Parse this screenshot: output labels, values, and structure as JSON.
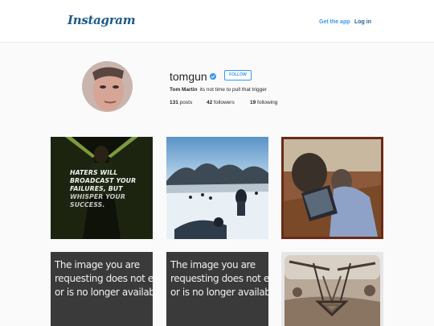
{
  "header": {
    "logo_text": "Instagram",
    "get_app_label": "Get the app",
    "login_label": "Log in"
  },
  "profile": {
    "username": "tomgun",
    "verified": true,
    "follow_label": "FOLLOW",
    "full_name": "Tom Martin",
    "bio": "its not time to pull that trigger",
    "stats": {
      "posts_count": "131",
      "posts_label": "posts",
      "followers_count": "42",
      "followers_label": "followers",
      "following_count": "19",
      "following_label": "following"
    }
  },
  "posts": {
    "quote_lines": [
      "HATERS WILL",
      "BROADCAST YOUR",
      "FAILURES, BUT",
      "WHISPER YOUR",
      "SUCCESS."
    ],
    "missing_lines": [
      "The image you are",
      "requesting does not exist",
      "or is no longer available."
    ]
  },
  "colors": {
    "link_blue": "#3897f0",
    "login_blue": "#1f5fa0",
    "logo_blue": "#1d5a8a",
    "background": "#fafafa"
  }
}
